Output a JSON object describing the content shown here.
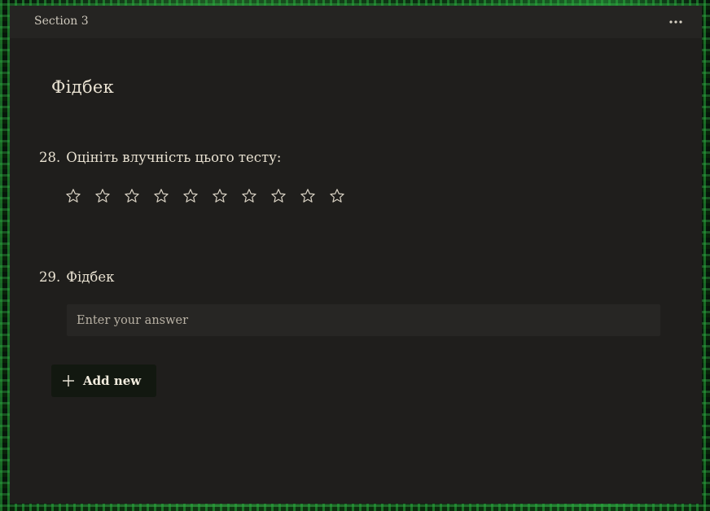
{
  "section": {
    "title": "Section 3",
    "more_icon": "more-horizontal-icon"
  },
  "page": {
    "title": "Фідбек"
  },
  "questions": [
    {
      "number": "28.",
      "title": "Оцініть влучність цього тесту:",
      "type": "rating",
      "rating_max": 10,
      "rating_value": 0,
      "star_icon": "star-outline-icon"
    },
    {
      "number": "29.",
      "title": "Фідбек",
      "type": "text",
      "value": "",
      "placeholder": "Enter your answer"
    }
  ],
  "add_new": {
    "label": "Add new",
    "icon": "plus-icon"
  },
  "colors": {
    "panel_bg": "#1f1e1c",
    "header_bg": "#252422",
    "text": "#e8e1d1",
    "input_bg": "#272624",
    "button_bg": "#121810"
  }
}
